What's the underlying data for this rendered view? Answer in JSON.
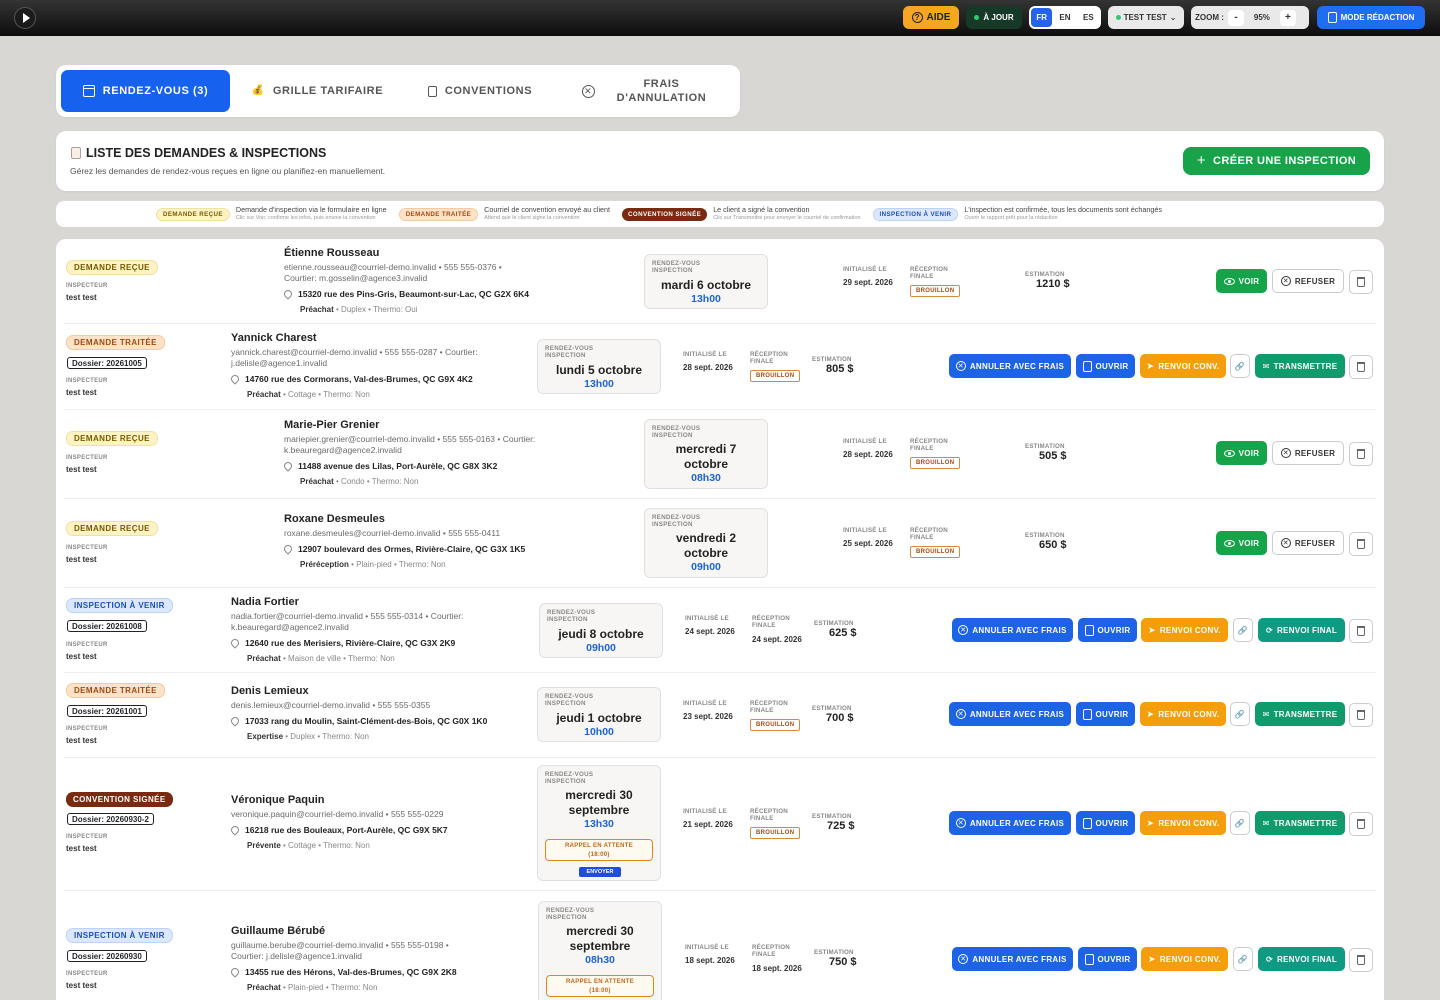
{
  "topbar": {
    "aide": "AIDE",
    "a_jour": "À JOUR",
    "langs": [
      "FR",
      "EN",
      "ES"
    ],
    "user": "TEST TEST",
    "zoom_label": "ZOOM :",
    "zoom_minus": "-",
    "zoom_value": "95%",
    "zoom_plus": "+",
    "mode": "MODE RÉDACTION"
  },
  "tabs": {
    "rdv": "RENDEZ-VOUS (3)",
    "grille": "GRILLE TARIFAIRE",
    "conventions": "CONVENTIONS",
    "frais_l1": "FRAIS",
    "frais_l2": "D'ANNULATION"
  },
  "header": {
    "title": "LISTE DES DEMANDES & INSPECTIONS",
    "subtitle": "Gérez les demandes de rendez-vous reçues en ligne ou planifiez-en manuellement.",
    "create": "CRÉER UNE INSPECTION"
  },
  "legend": [
    {
      "pill": "DEMANDE REÇUE",
      "text": "Demande d'inspection via le formulaire en ligne",
      "sub": "Clic sur Voir, confirme les infos, puis envoie la convention"
    },
    {
      "pill": "DEMANDE TRAITÉE",
      "text": "Courriel de convention envoyé au client",
      "sub": "Attend que le client signe la convention"
    },
    {
      "pill": "CONVENTION SIGNÉE",
      "text": "Le client a signé la convention",
      "sub": "Clic sur Transmettre pour envoyer le courriel de confirmation"
    },
    {
      "pill": "INSPECTION À VENIR",
      "text": "L'inspection est confirmée, tous les documents sont échangés",
      "sub": "Ouvrir le rapport prêt pour la rédaction"
    }
  ],
  "labels": {
    "inspecteur": "INSPECTEUR",
    "rdv_l1": "RENDEZ-VOUS",
    "rdv_l2": "INSPECTION",
    "init_l1": "INITIALISÉ LE",
    "rec_l1": "RÉCEPTION",
    "rec_l2": "FINALE",
    "estimation": "ESTIMATION",
    "brouillon": "BROUILLON",
    "voir": "VOIR",
    "refuser": "REFUSER",
    "annuler": "ANNULER AVEC FRAIS",
    "ouvrir": "OUVRIR",
    "renvoi_conv": "RENVOI CONV.",
    "transmettre": "TRANSMETTRE",
    "renvoi_final": "RENVOI FINAL",
    "rappel_l1": "RAPPEL EN ATTENTE",
    "rappel_l2": "(18:00)",
    "envoyer": "ENVOYER"
  },
  "rows": [
    {
      "status": "DEMANDE REÇUE",
      "dossier": "",
      "inspector": "test test",
      "name": "Étienne Rousseau",
      "contact": "etienne.rousseau@courriel-demo.invalid • 555 555-0376 •",
      "contact2": "Courtier: m.gosselin@agence3.invalid",
      "address": "15320 rue des Pins-Gris, Beaumont-sur-Lac, QC G2X 6K4",
      "type_main": "Préachat",
      "type_rest": " • Duplex • Thermo: Oui",
      "date_l1": "mardi 6 octobre",
      "date_l2": "",
      "time": "13h00",
      "init": "29 sept. 2026",
      "final": "",
      "estimate": "1210 $"
    },
    {
      "status": "DEMANDE TRAITÉE",
      "dossier": "Dossier: 20261005",
      "inspector": "test test",
      "name": "Yannick Charest",
      "contact": "yannick.charest@courriel-demo.invalid • 555 555-0287 • Courtier:",
      "contact2": "j.delisle@agence1.invalid",
      "address": "14760 rue des Cormorans, Val-des-Brumes, QC G9X 4K2",
      "type_main": "Préachat",
      "type_rest": " • Cottage • Thermo: Non",
      "date_l1": "lundi 5 octobre",
      "date_l2": "",
      "time": "13h00",
      "init": "28 sept. 2026",
      "final": "",
      "estimate": "805 $"
    },
    {
      "status": "DEMANDE REÇUE",
      "dossier": "",
      "inspector": "test test",
      "name": "Marie-Pier Grenier",
      "contact": "mariepier.grenier@courriel-demo.invalid • 555 555-0163 • Courtier:",
      "contact2": "k.beauregard@agence2.invalid",
      "address": "11488 avenue des Lilas, Port-Aurèle, QC G8X 3K2",
      "type_main": "Préachat",
      "type_rest": " • Condo • Thermo: Non",
      "date_l1": "mercredi 7",
      "date_l2": "octobre",
      "time": "08h30",
      "init": "28 sept. 2026",
      "final": "",
      "estimate": "505 $"
    },
    {
      "status": "DEMANDE REÇUE",
      "dossier": "",
      "inspector": "test test",
      "name": "Roxane Desmeules",
      "contact": "roxane.desmeules@courriel-demo.invalid • 555 555-0411",
      "contact2": "",
      "address": "12907 boulevard des Ormes, Rivière-Claire, QC G3X 1K5",
      "type_main": "Préréception",
      "type_rest": " • Plain-pied • Thermo: Non",
      "date_l1": "vendredi 2",
      "date_l2": "octobre",
      "time": "09h00",
      "init": "25 sept. 2026",
      "final": "",
      "estimate": "650 $"
    },
    {
      "status": "INSPECTION À VENIR",
      "dossier": "Dossier: 20261008",
      "inspector": "test test",
      "name": "Nadia Fortier",
      "contact": "nadia.fortier@courriel-demo.invalid • 555 555-0314 • Courtier:",
      "contact2": "k.beauregard@agence2.invalid",
      "address": "12640 rue des Merisiers, Rivière-Claire, QC G3X 2K9",
      "type_main": "Préachat",
      "type_rest": " • Maison de ville • Thermo: Non",
      "date_l1": "jeudi 8 octobre",
      "date_l2": "",
      "time": "09h00",
      "init": "24 sept. 2026",
      "final": "24 sept. 2026",
      "estimate": "625 $"
    },
    {
      "status": "DEMANDE TRAITÉE",
      "dossier": "Dossier: 20261001",
      "inspector": "test test",
      "name": "Denis Lemieux",
      "contact": "denis.lemieux@courriel-demo.invalid • 555 555-0355",
      "contact2": "",
      "address": "17033 rang du Moulin, Saint-Clément-des-Bois, QC G0X 1K0",
      "type_main": "Expertise",
      "type_rest": " • Duplex • Thermo: Non",
      "date_l1": "jeudi 1 octobre",
      "date_l2": "",
      "time": "10h00",
      "init": "23 sept. 2026",
      "final": "",
      "estimate": "700 $"
    },
    {
      "status": "CONVENTION SIGNÉE",
      "dossier": "Dossier: 20260930-2",
      "inspector": "test test",
      "name": "Véronique Paquin",
      "contact": "veronique.paquin@courriel-demo.invalid • 555 555-0229",
      "contact2": "",
      "address": "16218 rue des Bouleaux, Port-Aurèle, QC G9X 5K7",
      "type_main": "Prévente",
      "type_rest": " • Cottage • Thermo: Non",
      "date_l1": "mercredi 30",
      "date_l2": "septembre",
      "time": "13h30",
      "init": "21 sept. 2026",
      "final": "",
      "estimate": "725 $"
    },
    {
      "status": "INSPECTION À VENIR",
      "dossier": "Dossier: 20260930",
      "inspector": "test test",
      "name": "Guillaume Bérubé",
      "contact": "guillaume.berube@courriel-demo.invalid • 555 555-0198 •",
      "contact2": "Courtier: j.delisle@agence1.invalid",
      "address": "13455 rue des Hérons, Val-des-Brumes, QC G9X 2K8",
      "type_main": "Préachat",
      "type_rest": " • Plain-pied • Thermo: Non",
      "date_l1": "mercredi 30",
      "date_l2": "septembre",
      "time": "08h30",
      "init": "18 sept. 2026",
      "final": "18 sept. 2026",
      "estimate": "750 $"
    }
  ]
}
